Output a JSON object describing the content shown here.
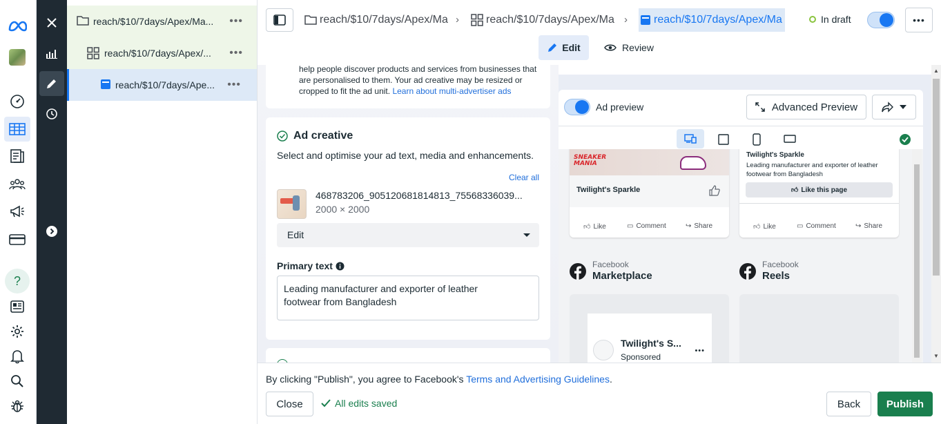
{
  "window": {
    "top_strip_color": "#c9ccd6"
  },
  "tree": {
    "campaign": {
      "label": "reach/$10/7days/Apex/Ma..."
    },
    "adset": {
      "label": "reach/$10/7days/Apex/..."
    },
    "ad": {
      "label": "reach/$10/7days/Ape..."
    }
  },
  "breadcrumbs": [
    {
      "label": "reach/$10/7days/Apex/Ma"
    },
    {
      "label": "reach/$10/7days/Apex/Ma"
    },
    {
      "label": "reach/$10/7days/Apex/Ma"
    }
  ],
  "status": {
    "label": "In draft",
    "dot_color": "#8ac43f"
  },
  "subtabs": {
    "edit": "Edit",
    "review": "Review"
  },
  "editor": {
    "intro_text": "help people discover products and services from businesses that are personalised to them. Your ad creative may be resized or cropped to fit the ad unit.",
    "intro_link": "Learn about multi-advertiser ads",
    "creative": {
      "title": "Ad creative",
      "description": "Select and optimise your ad text, media and enhancements.",
      "clear_all": "Clear all",
      "media_name": "468783206_905120681814813_75568336039...",
      "media_size": "2000 × 2000",
      "edit_dropdown": "Edit",
      "primary_text_label": "Primary text",
      "primary_text_value": "Leading manufacturer and exporter of leather footwear from Bangladesh"
    }
  },
  "preview": {
    "toggle_label": "Ad preview",
    "advanced_button": "Advanced Preview",
    "post_left": {
      "logo_line1": "SNEAKER",
      "logo_line2": "MANIA",
      "page_name": "Twilight's Sparkle",
      "like": "Like",
      "comment": "Comment",
      "share": "Share"
    },
    "post_right": {
      "page_name": "Twilight's Sparkle",
      "text": "Leading manufacturer and exporter of leather footwear from Bangladesh",
      "like_page": "Like this page",
      "like": "Like",
      "comment": "Comment",
      "share": "Share"
    },
    "placement_marketplace": {
      "platform": "Facebook",
      "name": "Marketplace"
    },
    "placement_reels": {
      "platform": "Facebook",
      "name": "Reels"
    },
    "marketplace_card": {
      "page_name": "Twilight's S...",
      "sponsored": "Sponsored"
    }
  },
  "footer": {
    "agreement_prefix": "By clicking \"Publish\", you agree to Facebook's",
    "agreement_link": "Terms and Advertising Guidelines",
    "agreement_suffix": ".",
    "close": "Close",
    "saved": "All edits saved",
    "back": "Back",
    "publish": "Publish"
  },
  "colors": {
    "brand_blue": "#1877f2",
    "publish_green": "#1a7f4e",
    "saved_green": "#1a7f4e"
  }
}
